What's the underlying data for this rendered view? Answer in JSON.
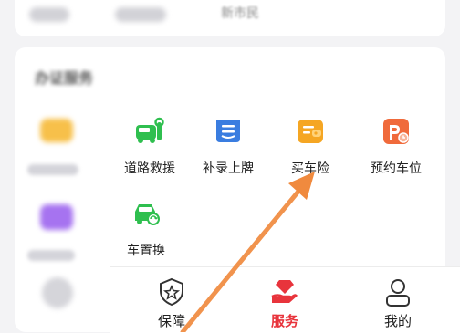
{
  "top_strip": {
    "label": "新市民"
  },
  "services": {
    "title": "办证服务",
    "items": [
      {
        "label": "道路救援",
        "icon": "roadside-assistance-icon",
        "color": "#2fbf4f"
      },
      {
        "label": "补录上牌",
        "icon": "plate-registration-icon",
        "color": "#3a7de0"
      },
      {
        "label": "买车险",
        "icon": "car-insurance-icon",
        "color": "#f5a623"
      },
      {
        "label": "预约车位",
        "icon": "parking-reservation-icon",
        "color": "#f06a3b"
      },
      {
        "label": "车置换",
        "icon": "car-exchange-icon",
        "color": "#2fbf4f"
      }
    ]
  },
  "tabbar": {
    "tabs": [
      {
        "label": "保障",
        "icon": "shield-star-icon",
        "active": false
      },
      {
        "label": "服务",
        "icon": "hand-diamond-icon",
        "active": true
      },
      {
        "label": "我的",
        "icon": "person-icon",
        "active": false
      }
    ],
    "accent": "#e8343c"
  },
  "overlay": {
    "arrow_color": "#f08a3e"
  }
}
